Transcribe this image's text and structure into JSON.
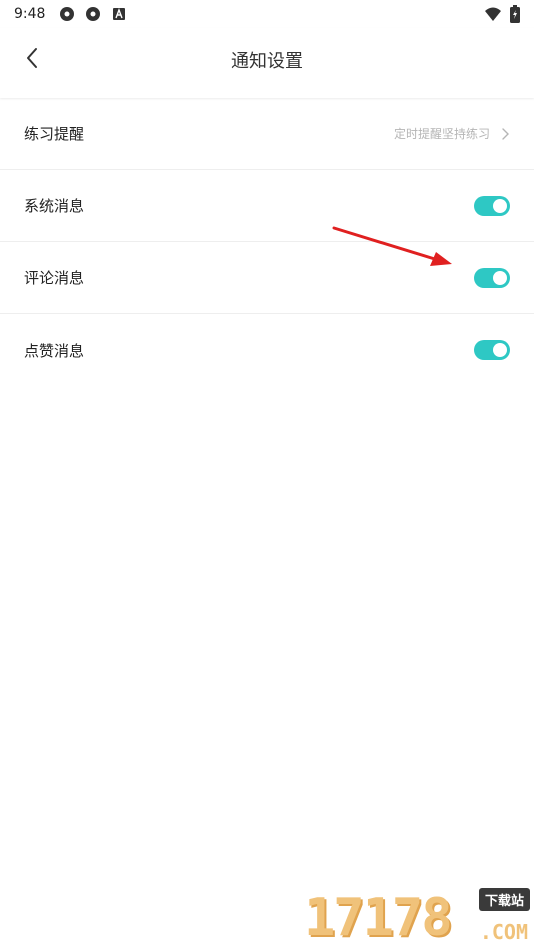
{
  "status_bar": {
    "time": "9:48",
    "icons": [
      "gear-icon",
      "gear-icon",
      "a-icon"
    ],
    "right_icons": [
      "wifi-icon",
      "battery-icon"
    ]
  },
  "header": {
    "title": "通知设置",
    "back_icon": "chevron-left-icon"
  },
  "settings": {
    "items": [
      {
        "label": "练习提醒",
        "value": "定时提醒坚持练习",
        "type": "link"
      },
      {
        "label": "系统消息",
        "type": "toggle",
        "on": true
      },
      {
        "label": "评论消息",
        "type": "toggle",
        "on": true
      },
      {
        "label": "点赞消息",
        "type": "toggle",
        "on": true
      }
    ]
  },
  "colors": {
    "toggle_on": "#2ec8c4",
    "annotation_arrow": "#e02020",
    "watermark": "#f0c27a"
  },
  "watermark": {
    "number": "17178",
    "badge": "下载站",
    "domain": ".COM"
  }
}
